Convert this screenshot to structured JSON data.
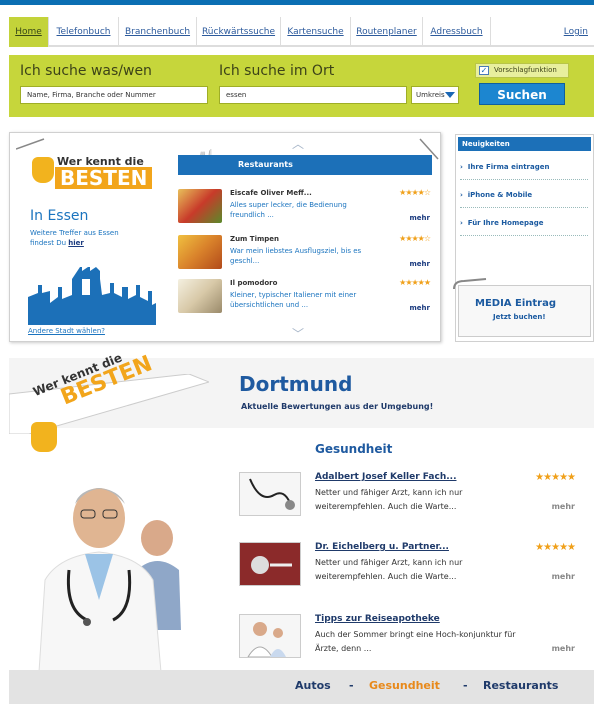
{
  "nav": {
    "tabs": [
      "Home",
      "Telefonbuch",
      "Branchenbuch",
      "Rückwärtssuche",
      "Kartensuche",
      "Routenplaner",
      "Adressbuch"
    ],
    "login": "Login"
  },
  "search": {
    "label_what": "Ich suche was/wen",
    "label_where": "Ich suche im Ort",
    "what_placeholder": "Name, Firma, Branche oder Nummer",
    "where_value": "essen",
    "radius": "Umkreis",
    "suggest_label": "Vorschlagfunktion",
    "suggest_checked": true,
    "button": "Suchen"
  },
  "widget": {
    "logo_line1": "Wer kennt die",
    "logo_line2": "BESTEN",
    "city": "In Essen",
    "more_hits_text": "Weitere Treffer aus Essen findest Du",
    "more_hits_link": "hier",
    "change_city": "Andere Stadt wählen?",
    "category": "Restaurants",
    "items": [
      {
        "name": "Eiscafe Oliver Meff...",
        "desc": "Alles super lecker, die Bedienung freundlich ...",
        "rating": 4,
        "more": "mehr"
      },
      {
        "name": "Zum Timpen",
        "desc": "War mein liebstes Ausflugsziel, bis es geschl...",
        "rating": 4,
        "more": "mehr"
      },
      {
        "name": "Il pomodoro",
        "desc": "Kleiner, typischer Italiener mit einer übersichtlichen und ...",
        "rating": 5,
        "more": "mehr"
      }
    ]
  },
  "news": {
    "title": "Neuigkeiten",
    "items": [
      "Ihre Firma eintragen",
      "iPhone & Mobile",
      "Für Ihre Homepage"
    ],
    "media_title": "MEDIA Eintrag",
    "media_sub": "Jetzt buchen!"
  },
  "ad": {
    "banner_line1": "Wer kennt die",
    "banner_line2": "BESTEN",
    "city": "Dortmund",
    "subtitle": "Aktuelle Bewertungen aus der Umgebung!",
    "section": "Gesundheit",
    "articles": [
      {
        "title": "Adalbert Josef Keller Fach...",
        "text": "Netter und fähiger Arzt, kann ich nur weiterempfehlen. Auch die Warte...",
        "rating": 5,
        "more": "mehr"
      },
      {
        "title": "Dr. Eichelberg u. Partner...",
        "text": "Netter und fähiger Arzt, kann ich nur weiterempfehlen. Auch die Warte...",
        "rating": 5,
        "more": "mehr"
      },
      {
        "title": "Tipps zur Reiseapotheke",
        "text": "Auch der Sommer bringt eine Hoch-konjunktur für Ärzte, denn ...",
        "rating": 0,
        "more": "mehr"
      }
    ],
    "categories": [
      "Autos",
      "Gesundheit",
      "Restaurants"
    ],
    "separator": "-",
    "colors": {
      "active": "#e8891a",
      "normal": "#1f3a6a"
    }
  }
}
